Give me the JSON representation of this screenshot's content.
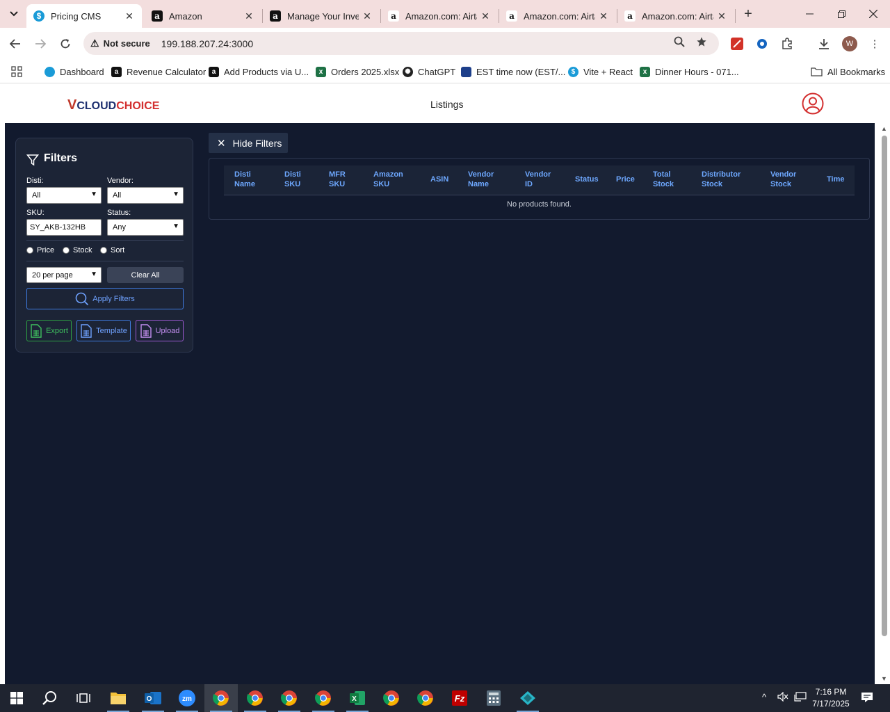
{
  "browser": {
    "tabs": [
      {
        "title": "Pricing CMS",
        "icon": "s-logo-icon",
        "active": true
      },
      {
        "title": "Amazon",
        "icon": "amazon-icon"
      },
      {
        "title": "Manage Your Inve",
        "icon": "amazon-icon"
      },
      {
        "title": "Amazon.com: Airta",
        "icon": "amazon-icon"
      },
      {
        "title": "Amazon.com: Airta",
        "icon": "amazon-icon"
      },
      {
        "title": "Amazon.com: Airta",
        "icon": "amazon-icon"
      }
    ],
    "security_label": "Not secure",
    "url": "199.188.207.24:3000",
    "profile_initial": "W",
    "bookmarks": [
      {
        "label": "Dashboard",
        "color": "#1a9bd7"
      },
      {
        "label": "Revenue Calculator",
        "color": "#111111"
      },
      {
        "label": "Add Products via U...",
        "color": "#111111"
      },
      {
        "label": "Orders 2025.xlsx",
        "color": "#1e7145"
      },
      {
        "label": "ChatGPT",
        "color": "#222222"
      },
      {
        "label": "EST time now (EST/...",
        "color": "#1d3f8a"
      },
      {
        "label": "Vite + React",
        "color": "#1a9bd7"
      },
      {
        "label": "Dinner Hours - 071...",
        "color": "#1e7145"
      }
    ],
    "all_bookmarks_label": "All Bookmarks"
  },
  "app": {
    "logo_prefix": "V",
    "logo_main": "CLOUD",
    "logo_suffix": "CHOICE",
    "title": "Listings"
  },
  "filters": {
    "heading": "Filters",
    "disti_label": "Disti:",
    "disti_value": "All",
    "vendor_label": "Vendor:",
    "vendor_value": "All",
    "sku_label": "SKU:",
    "sku_value": "SY_AKB-132HB",
    "status_label": "Status:",
    "status_value": "Any",
    "radio_price": "Price",
    "radio_stock": "Stock",
    "radio_sort": "Sort",
    "per_page": "20 per page",
    "clear_all": "Clear All",
    "apply": "Apply Filters",
    "export": "Export",
    "template": "Template",
    "upload": "Upload"
  },
  "hide_filters_label": "Hide Filters",
  "table": {
    "columns": [
      [
        "Disti",
        "Name"
      ],
      [
        "Disti",
        "SKU"
      ],
      [
        "MFR",
        "SKU"
      ],
      [
        "Amazon",
        "SKU"
      ],
      [
        "ASIN",
        ""
      ],
      [
        "Vendor",
        "Name"
      ],
      [
        "Vendor",
        "ID"
      ],
      [
        "Status",
        ""
      ],
      [
        "Price",
        ""
      ],
      [
        "Total",
        "Stock"
      ],
      [
        "Distributor",
        "Stock"
      ],
      [
        "Vendor",
        "Stock"
      ],
      [
        "Time",
        ""
      ]
    ],
    "empty_message": "No products found."
  },
  "taskbar": {
    "time": "7:16 PM",
    "date": "7/17/2025"
  },
  "colors": {
    "page_bg": "#121a2e",
    "panel_bg": "#1c2436",
    "accent_blue": "#3f7be0",
    "header_text": "#6ea8ff",
    "export_green": "#2ea043",
    "template_blue": "#3f7be0",
    "upload_purple": "#9b59d0"
  }
}
